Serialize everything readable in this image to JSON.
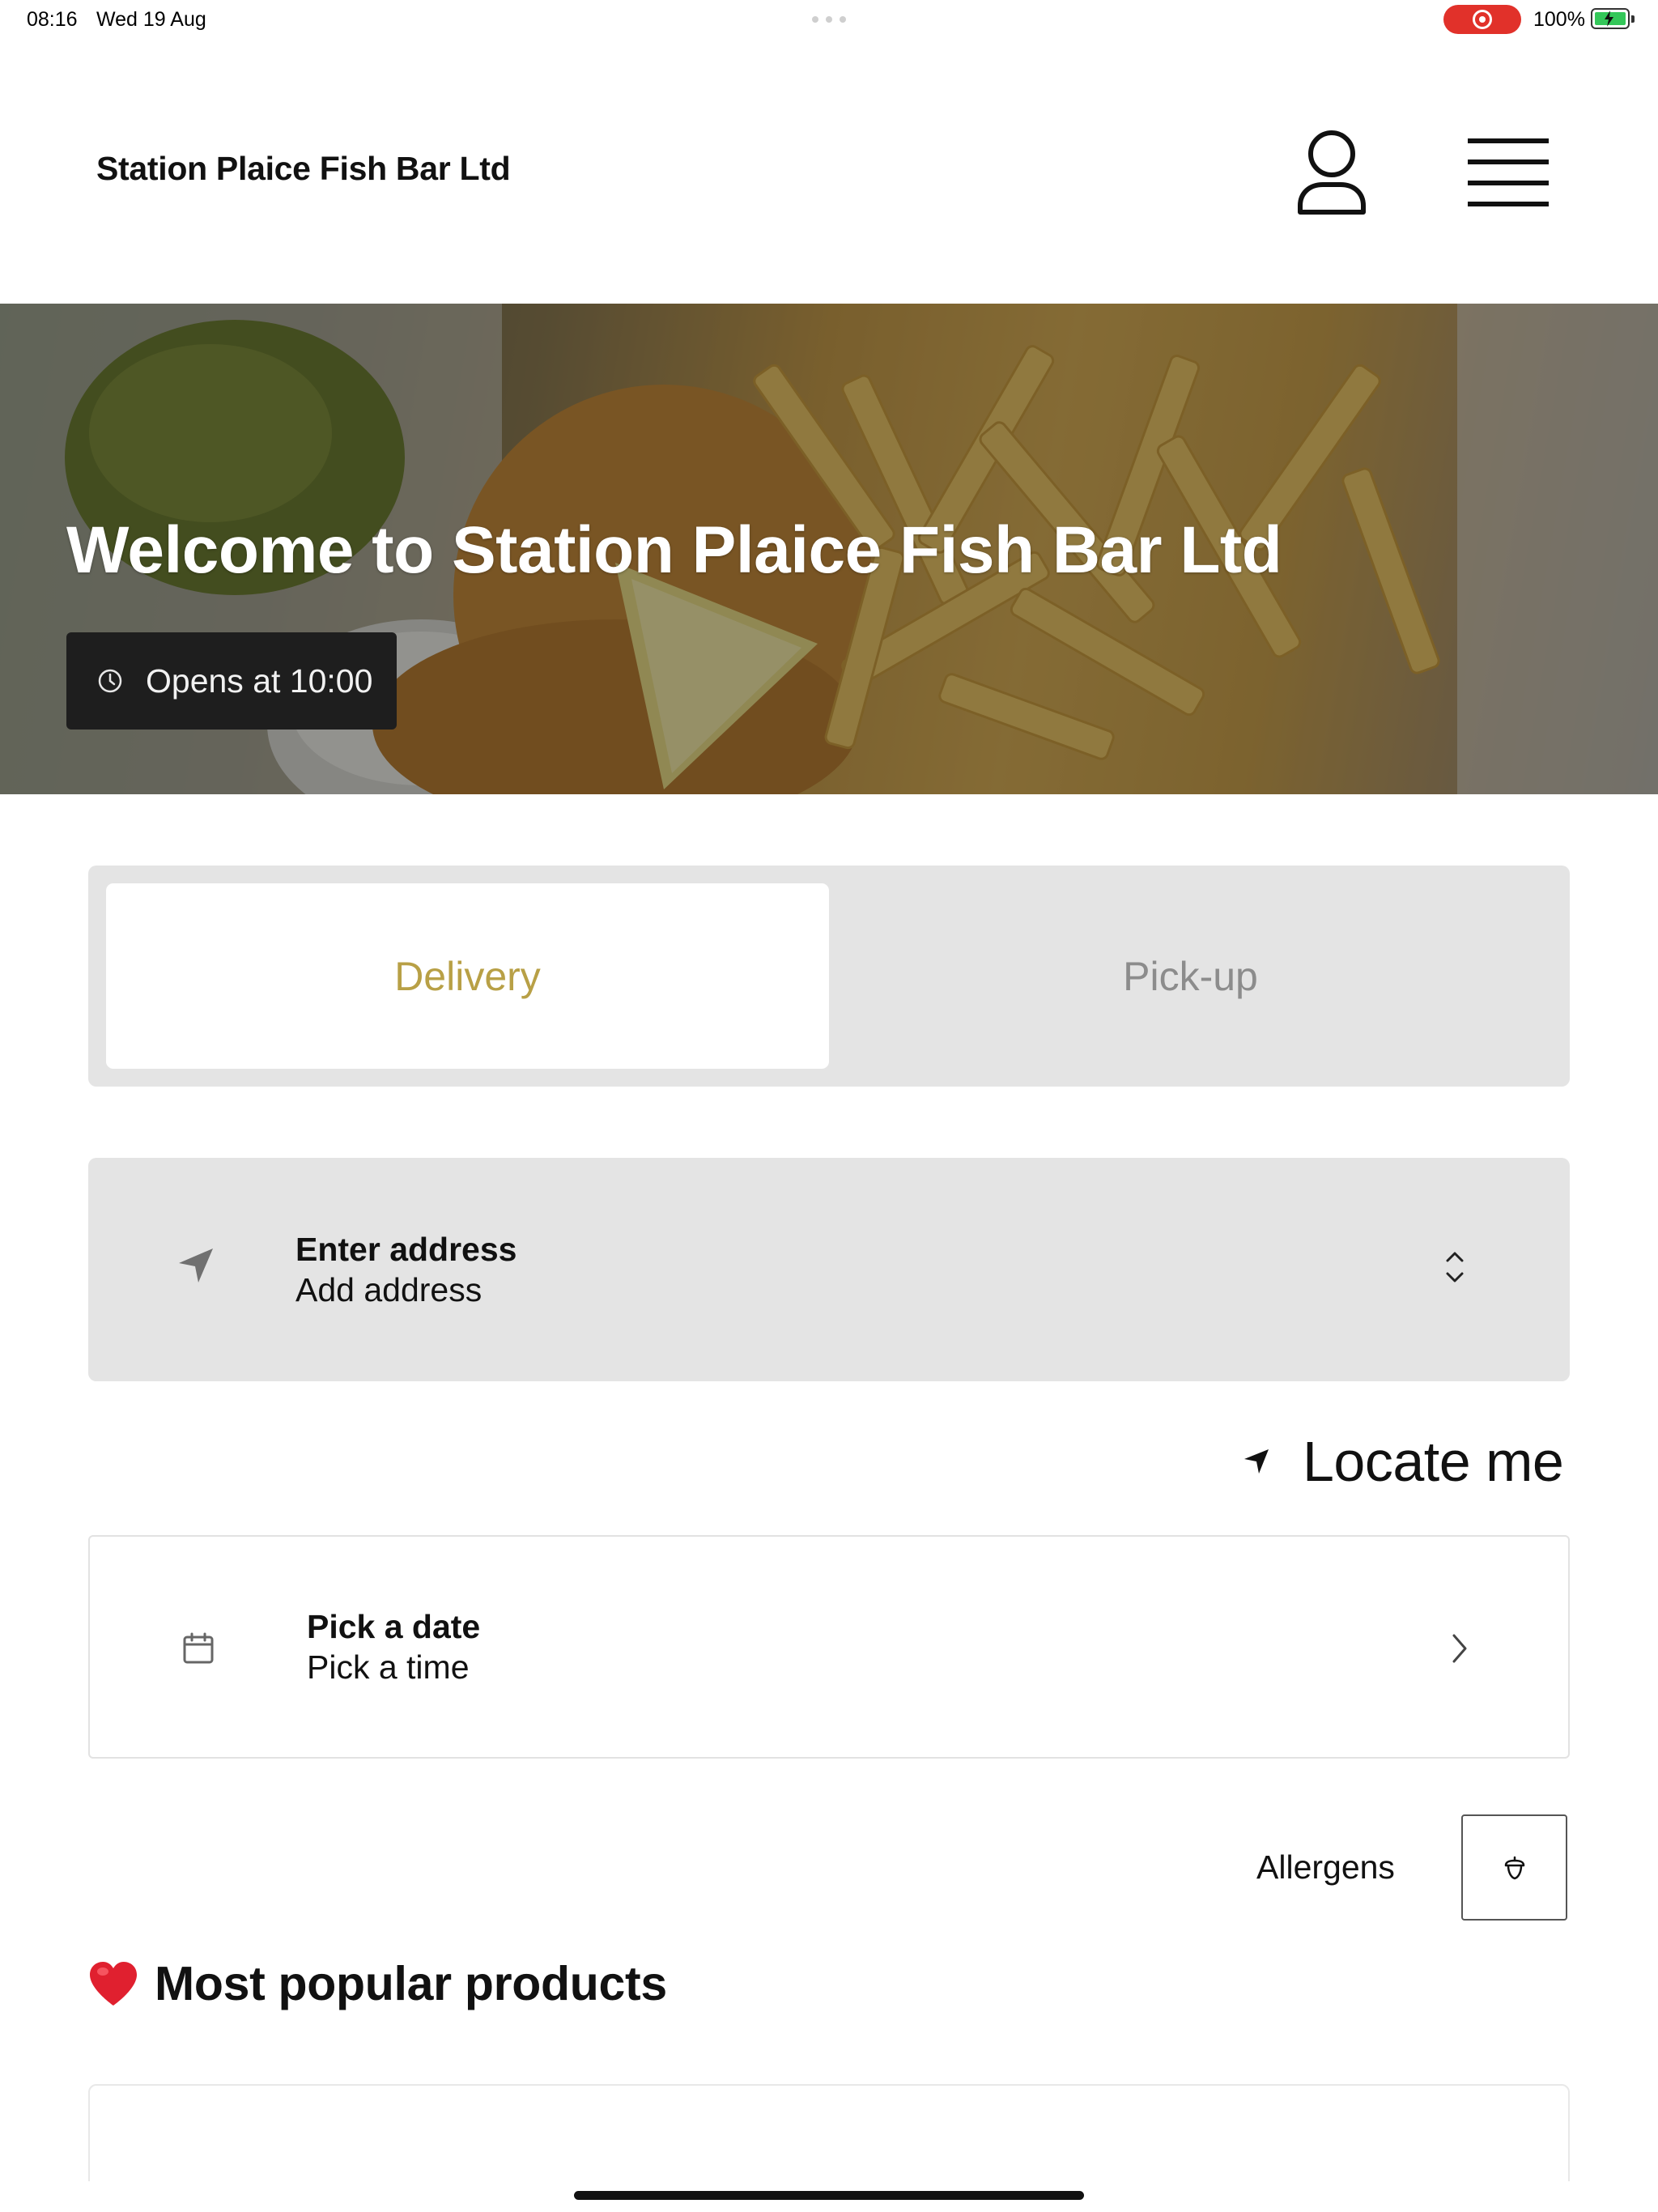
{
  "status_bar": {
    "time": "08:16",
    "date": "Wed 19 Aug",
    "battery_percent": "100%",
    "battery_level": 1.0,
    "recording_color": "#e1312a",
    "battery_color": "#34c759"
  },
  "header": {
    "brand": "Station Plaice Fish Bar Ltd",
    "user_icon": "person-outline-icon",
    "menu_icon": "hamburger-menu-icon"
  },
  "hero": {
    "title": "Welcome to Station Plaice Fish Bar Ltd",
    "opens_text": "Opens at 10:00",
    "clock_icon": "clock-icon"
  },
  "mode_toggle": {
    "tabs": [
      {
        "label": "Delivery",
        "active": true
      },
      {
        "label": "Pick-up",
        "active": false
      }
    ],
    "active_color": "#b8a046"
  },
  "address": {
    "title": "Enter address",
    "subtitle": "Add address",
    "icon": "navigation-arrow-icon",
    "chevron_icon": "chevron-up-down-icon"
  },
  "locate": {
    "label": "Locate me",
    "icon": "location-arrow-icon"
  },
  "schedule": {
    "title": "Pick a date",
    "subtitle": "Pick a time",
    "icon": "calendar-icon",
    "chevron_icon": "chevron-right-icon"
  },
  "allergens": {
    "label": "Allergens",
    "icon": "acorn-icon"
  },
  "popular": {
    "title": "Most popular products",
    "icon": "heart-icon"
  }
}
